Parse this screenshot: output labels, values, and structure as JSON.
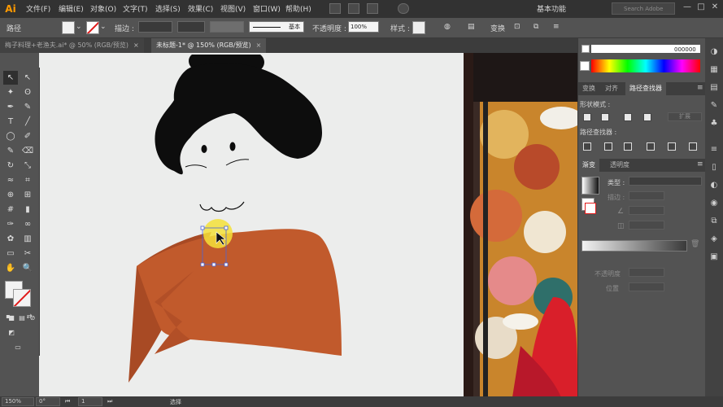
{
  "app": {
    "logo": "Ai",
    "accent": "#ff9a00"
  },
  "menu": {
    "items": [
      "文件(F)",
      "编辑(E)",
      "对象(O)",
      "文字(T)",
      "选择(S)",
      "效果(C)",
      "视图(V)",
      "窗口(W)",
      "帮助(H)"
    ]
  },
  "menubar_right": {
    "workspace": "基本功能",
    "search_placeholder": "Search Adobe Stock",
    "window_buttons": [
      "—",
      "□",
      "✕"
    ]
  },
  "control_bar": {
    "selection_label": "路径",
    "stroke_label": "描边 :",
    "stroke_profile": "基本",
    "opacity_label": "不透明度 :",
    "opacity_value": "100%",
    "style_label": "样式 :",
    "transform_label": "变换",
    "fill_color": "#f2f2f2",
    "stroke_color": "none"
  },
  "document_tabs": [
    {
      "title": "梅子料理+老渔夫.ai* @ 50% (RGB/预览)",
      "close": "×",
      "active": false
    },
    {
      "title": "未标题-1* @ 150% (RGB/预览)",
      "close": "×",
      "active": true
    }
  ],
  "tools": {
    "icons": [
      "selection-icon",
      "direct-selection-icon",
      "magic-wand-icon",
      "lasso-icon",
      "pen-icon",
      "curvature-icon",
      "type-icon",
      "line-icon",
      "ellipse-icon",
      "paintbrush-icon",
      "shaper-icon",
      "eraser-icon",
      "rotate-icon",
      "scale-icon",
      "warp-icon",
      "free-transform-icon",
      "shape-builder-icon",
      "perspective-icon",
      "mesh-icon",
      "gradient-icon",
      "eyedropper-icon",
      "blend-icon",
      "symbol-sprayer-icon",
      "column-graph-icon",
      "artboard-icon",
      "slice-icon",
      "hand-icon",
      "zoom-icon"
    ],
    "glyphs": [
      "↖",
      "↖",
      "✦",
      "ʘ",
      "✒",
      "✎",
      "T",
      "╱",
      "◯",
      "✐",
      "✎",
      "⌫",
      "↻",
      "⤡",
      "≈",
      "⌗",
      "⊕",
      "⊞",
      "#",
      "▮",
      "✑",
      "∞",
      "✿",
      "▥",
      "▭",
      "✂",
      "✋",
      "🔍"
    ]
  },
  "color_picker": {
    "hex_label": "000000"
  },
  "panel_tabs_top": [
    "变换",
    "对齐",
    "路径查找器"
  ],
  "pathfinder": {
    "shape_modes_label": "形状模式 :",
    "expand_label": "扩展",
    "pathfinders_label": "路径查找器 :"
  },
  "gradient_panel": {
    "tabs": [
      "渐变",
      "透明度"
    ],
    "type_label": "类型 :",
    "stroke_label": "描边 :",
    "opacity_label": "不透明度",
    "location_label": "位置"
  },
  "status_bar": {
    "zoom": "150%",
    "angle": "0°",
    "artboard": "1",
    "tool": "选择"
  },
  "canvas": {
    "artboard_color": "#ecedec",
    "kimono_color": "#c15a2c",
    "kimono_shadow": "#a84a24",
    "hair_color": "#0d0d0d"
  }
}
